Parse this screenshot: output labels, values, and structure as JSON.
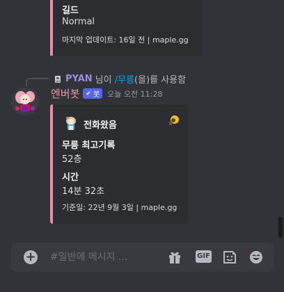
{
  "prev_embed": {
    "field_name": "길드",
    "field_value": "Normal",
    "footer": "마지막 업데이트: 16일 전 | maple.gg"
  },
  "reply": {
    "username": "PYAN",
    "suffix": "님이",
    "command": "/무릉",
    "tail": "(을)를 사용함"
  },
  "message": {
    "author": "엔버봇",
    "badge": "봇",
    "timestamp": "오늘 오전 11:28"
  },
  "embed": {
    "author_name": "전화왔음",
    "field1_name": "무릉 최고기록",
    "field1_value": "52층",
    "field2_name": "시간",
    "field2_value": "14분 32초",
    "footer": "기준일: 22년 9월 3일 | maple.gg",
    "accent_color": "#eb8fa0"
  },
  "composer": {
    "placeholder": "#일반에 메시지 ...",
    "gif_label": "GIF",
    "icons": [
      "add-icon",
      "gift-icon",
      "gif-icon",
      "sticker-icon",
      "emoji-icon"
    ]
  }
}
